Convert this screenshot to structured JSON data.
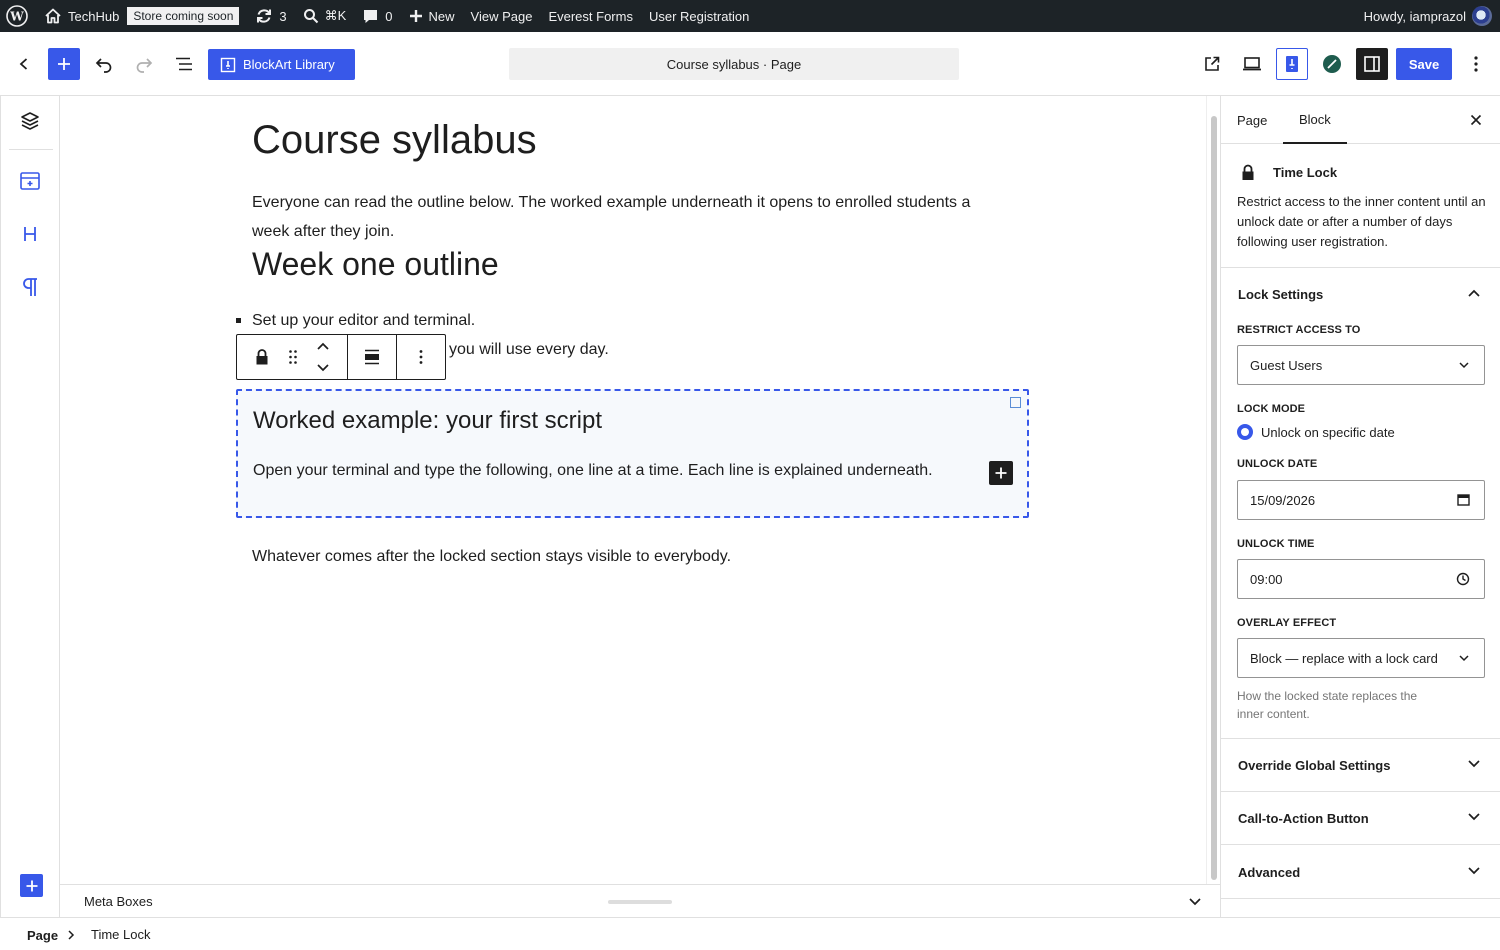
{
  "adminbar": {
    "site_name": "TechHub",
    "store_badge": "Store coming soon",
    "updates_count": "3",
    "command_shortcut": "⌘K",
    "comments_count": "0",
    "new_label": "New",
    "view_page": "View Page",
    "everest_forms": "Everest Forms",
    "user_registration": "User Registration",
    "howdy": "Howdy, iamprazol"
  },
  "header": {
    "blockart_label": "BlockArt Library",
    "document_title": "Course syllabus · Page",
    "save_label": "Save"
  },
  "content": {
    "title": "Course syllabus",
    "intro": "Everyone can read the outline below. The worked example underneath it opens to enrolled students a week after they join.",
    "heading": "Week one outline",
    "list_items": [
      "Set up your editor and terminal.",
      "you will use every day."
    ],
    "locked_heading": "Worked example: your first script",
    "locked_text": "Open your terminal and type the following, one line at a time. Each line is explained underneath.",
    "after_text": "Whatever comes after the locked section stays visible to everybody."
  },
  "meta_boxes_label": "Meta Boxes",
  "breadcrumb": {
    "root": "Page",
    "current": "Time Lock"
  },
  "sidebar": {
    "tabs": [
      "Page",
      "Block"
    ],
    "active_tab": "Block",
    "block_name": "Time Lock",
    "block_description": "Restrict access to the inner content until an unlock date or after a number of days following user registration.",
    "lock_settings": {
      "title": "Lock Settings",
      "restrict_label": "Restrict access to",
      "restrict_value": "Guest Users",
      "lock_mode_label": "Lock mode",
      "lock_mode_value": "Unlock on specific date",
      "unlock_date_label": "Unlock date",
      "unlock_date_value": "15/09/2026",
      "unlock_time_label": "Unlock time",
      "unlock_time_value": "09:00",
      "overlay_label": "Overlay effect",
      "overlay_value": "Block — replace with a lock card",
      "overlay_help": "How the locked state replaces the inner content."
    },
    "panels": [
      "Override Global Settings",
      "Call-to-Action Button",
      "Advanced"
    ]
  },
  "colors": {
    "accent": "#3858e9",
    "adminbar": "#1d2327"
  }
}
